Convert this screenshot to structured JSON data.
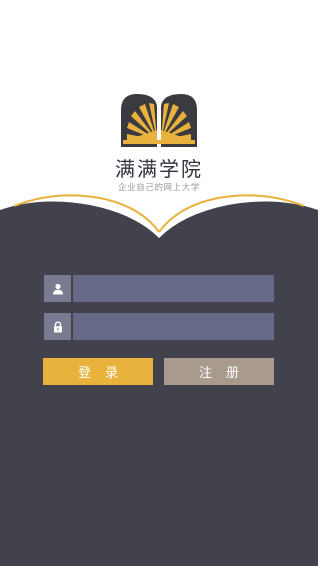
{
  "brand": {
    "name": "满满学院",
    "slogan": "企业自己的网上大学"
  },
  "form": {
    "username": {
      "icon": "user-icon",
      "value": "",
      "placeholder": ""
    },
    "password": {
      "icon": "lock-icon",
      "value": "",
      "placeholder": ""
    }
  },
  "buttons": {
    "login_label": "登录",
    "register_label": "注册"
  },
  "colors": {
    "dark_bg": "#42424c",
    "accent_yellow": "#e9b23c",
    "register_gray": "#a89a8c",
    "input_bg": "#676a86",
    "icon_bg": "#7a7b91"
  }
}
